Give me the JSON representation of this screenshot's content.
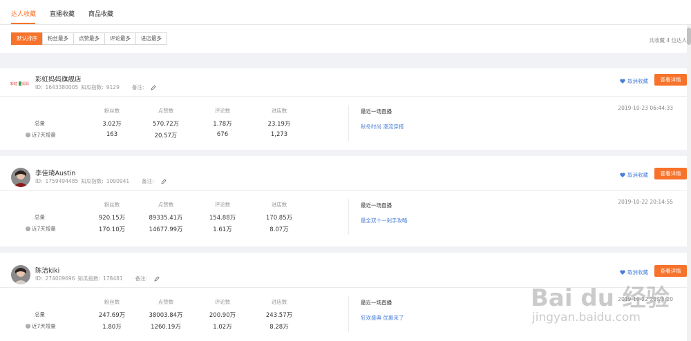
{
  "tabs": [
    {
      "label": "达人收藏",
      "active": true
    },
    {
      "label": "直播收藏",
      "active": false
    },
    {
      "label": "商品收藏",
      "active": false
    }
  ],
  "sort_options": [
    {
      "label": "默认排序",
      "active": true
    },
    {
      "label": "粉丝最多",
      "active": false
    },
    {
      "label": "点赞最多",
      "active": false
    },
    {
      "label": "评论最多",
      "active": false
    },
    {
      "label": "进店最多",
      "active": false
    }
  ],
  "total_text": "共收藏 4 位达人",
  "colors": {
    "accent": "#f7722a",
    "link": "#4a7fd8",
    "band": "#f0f2f5"
  },
  "stat_headers": [
    "粉丝数",
    "点赞数",
    "评论数",
    "进店数"
  ],
  "row_labels": {
    "total": "总量",
    "week": "近7天增量"
  },
  "labels": {
    "id_prefix": "ID:",
    "zhigua_prefix": "知瓜指数:",
    "note": "备注:",
    "unfollow": "取消收藏",
    "detail": "查看详情",
    "live_title": "最近一场直播"
  },
  "influencers": [
    {
      "name": "彩虹妈妈旗舰店",
      "id": "1643380005",
      "zhigua": "9129",
      "avatar_type": "logo",
      "totals": [
        "3.02万",
        "570.72万",
        "1.78万",
        "23.19万"
      ],
      "weekly": [
        "163",
        "20.57万",
        "676",
        "1,273"
      ],
      "date": "2019-10-23 06:44:33",
      "live_link": "秋冬时尚 潮流穿搭"
    },
    {
      "name": "李佳琦Austin",
      "id": "1759494485",
      "zhigua": "1090941",
      "avatar_type": "photo",
      "totals": [
        "920.15万",
        "89335.41万",
        "154.88万",
        "170.85万"
      ],
      "weekly": [
        "170.10万",
        "14677.99万",
        "1.61万",
        "8.07万"
      ],
      "date": "2019-10-22 20:14:55",
      "live_link": "最全双十一剁手攻略"
    },
    {
      "name": "陈洁kiki",
      "id": "274009696",
      "zhigua": "178481",
      "avatar_type": "photo",
      "totals": [
        "247.69万",
        "38003.84万",
        "200.90万",
        "243.57万"
      ],
      "weekly": [
        "1.80万",
        "1260.19万",
        "1.02万",
        "8.28万"
      ],
      "date": "2019-10-22 20:25:20",
      "live_link": "狂欢盛典 优惠来了"
    }
  ],
  "watermark": {
    "brand": "Bai du 经验",
    "url": "jingyan.baidu.com"
  }
}
